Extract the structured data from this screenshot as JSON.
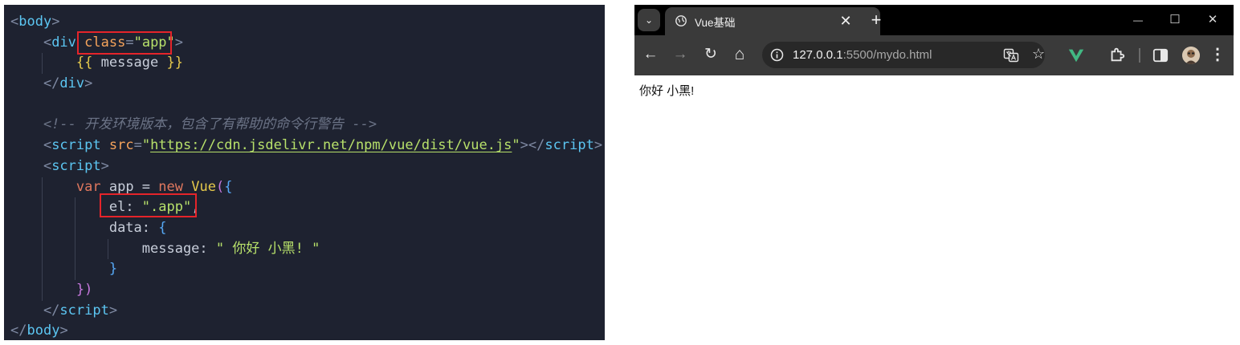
{
  "editor": {
    "lines": [
      [
        {
          "c": "t-punc",
          "t": "<"
        },
        {
          "c": "t-tag",
          "t": "body"
        },
        {
          "c": "t-punc",
          "t": ">"
        }
      ],
      [
        {
          "c": "t-punc",
          "t": "    <"
        },
        {
          "c": "t-tag",
          "t": "div"
        },
        {
          "c": "t-text",
          "t": " "
        },
        {
          "c": "t-attr",
          "t": "class"
        },
        {
          "c": "t-punc",
          "t": "="
        },
        {
          "c": "t-str",
          "t": "\"app\""
        },
        {
          "c": "t-punc",
          "t": ">"
        }
      ],
      [
        {
          "c": "t-text",
          "t": "        "
        },
        {
          "c": "t-brace",
          "t": "{{"
        },
        {
          "c": "t-text",
          "t": " message "
        },
        {
          "c": "t-brace",
          "t": "}}"
        }
      ],
      [
        {
          "c": "t-punc",
          "t": "    </"
        },
        {
          "c": "t-tag",
          "t": "div"
        },
        {
          "c": "t-punc",
          "t": ">"
        }
      ],
      [
        {
          "c": "t-text",
          "t": ""
        }
      ],
      [
        {
          "c": "t-com",
          "t": "    <!-- 开发环境版本，包含了有帮助的命令行警告 -->"
        }
      ],
      [
        {
          "c": "t-punc",
          "t": "    <"
        },
        {
          "c": "t-tag",
          "t": "script"
        },
        {
          "c": "t-text",
          "t": " "
        },
        {
          "c": "t-attr",
          "t": "src"
        },
        {
          "c": "t-punc",
          "t": "="
        },
        {
          "c": "t-str",
          "t": "\""
        },
        {
          "c": "t-link",
          "t": "https://cdn.jsdelivr.net/npm/vue/dist/vue.js"
        },
        {
          "c": "t-str",
          "t": "\""
        },
        {
          "c": "t-punc",
          "t": "></"
        },
        {
          "c": "t-tag",
          "t": "script"
        },
        {
          "c": "t-punc",
          "t": ">"
        }
      ],
      [
        {
          "c": "t-punc",
          "t": "    <"
        },
        {
          "c": "t-tag",
          "t": "script"
        },
        {
          "c": "t-punc",
          "t": ">"
        }
      ],
      [
        {
          "c": "t-text",
          "t": "        "
        },
        {
          "c": "t-kw",
          "t": "var"
        },
        {
          "c": "t-id",
          "t": " app "
        },
        {
          "c": "t-op",
          "t": "="
        },
        {
          "c": "t-kw",
          "t": " new"
        },
        {
          "c": "t-fn",
          "t": " Vue"
        },
        {
          "c": "t-paren",
          "t": "("
        },
        {
          "c": "t-brace2",
          "t": "{"
        }
      ],
      [
        {
          "c": "t-text",
          "t": "            "
        },
        {
          "c": "t-prop",
          "t": "el"
        },
        {
          "c": "t-op",
          "t": ": "
        },
        {
          "c": "t-str",
          "t": "\".app\""
        },
        {
          "c": "t-op",
          "t": ","
        }
      ],
      [
        {
          "c": "t-text",
          "t": "            "
        },
        {
          "c": "t-prop",
          "t": "data"
        },
        {
          "c": "t-op",
          "t": ": "
        },
        {
          "c": "t-brace2",
          "t": "{"
        }
      ],
      [
        {
          "c": "t-text",
          "t": "                "
        },
        {
          "c": "t-prop",
          "t": "message"
        },
        {
          "c": "t-op",
          "t": ": "
        },
        {
          "c": "t-str",
          "t": "\" 你好 小黑! \""
        }
      ],
      [
        {
          "c": "t-text",
          "t": "            "
        },
        {
          "c": "t-brace2",
          "t": "}"
        }
      ],
      [
        {
          "c": "t-text",
          "t": "        "
        },
        {
          "c": "t-paren",
          "t": "})"
        }
      ],
      [
        {
          "c": "t-punc",
          "t": "    </"
        },
        {
          "c": "t-tag",
          "t": "script"
        },
        {
          "c": "t-punc",
          "t": ">"
        }
      ],
      [
        {
          "c": "t-punc",
          "t": "</"
        },
        {
          "c": "t-tag",
          "t": "body"
        },
        {
          "c": "t-punc",
          "t": ">"
        }
      ]
    ],
    "colors": {
      "background": "#1e2230",
      "highlight": "#e5242a"
    }
  },
  "browser": {
    "tab_title": "Vue基础",
    "tab_close_glyph": "✕",
    "new_tab_glyph": "+",
    "tab_list_glyph": "⌄",
    "window": {
      "minimize": "—",
      "maximize": "☐",
      "close": "✕"
    },
    "toolbar": {
      "back": "←",
      "forward": "→",
      "reload": "↻",
      "home": "⌂",
      "star": "☆",
      "menu": "⋮"
    },
    "url_host": "127.0.0.1",
    "url_rest": ":5500/mydo.html",
    "page_text": "你好 小黑!",
    "colors": {
      "tabbar": "#000000",
      "toolbar": "#3a3a3a",
      "vue_green": "#42b883"
    }
  }
}
